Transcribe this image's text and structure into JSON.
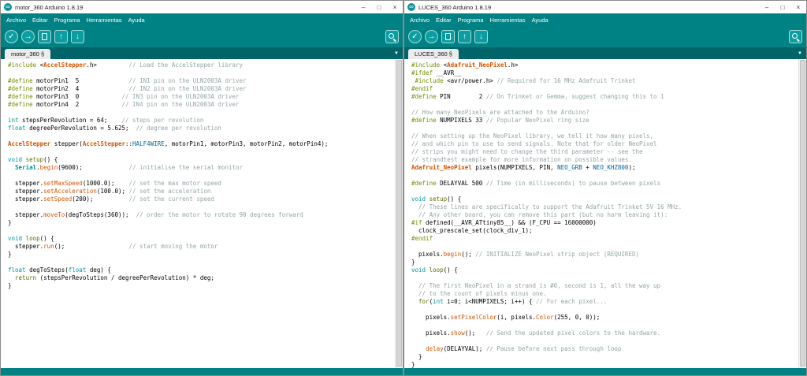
{
  "chrome": {
    "window_controls": {
      "minimize": "–",
      "maximize": "□",
      "close": "×"
    },
    "app_icon_glyph": "∞",
    "tab_menu_glyph": "▼",
    "toolbar": {
      "verify": "✓",
      "upload": "→",
      "open": "↑",
      "save": "↓"
    },
    "colors": {
      "toolbar_teal": "#008184",
      "tabstrip_teal": "#006468",
      "button_teal": "#0c9da1",
      "syntax_type": "#00979C",
      "syntax_function": "#D35400",
      "syntax_preprocessor": "#728E00",
      "syntax_keyword": "#5E6D03",
      "syntax_constant": "#006699",
      "syntax_comment": "#95A5A6"
    }
  },
  "windows": [
    {
      "title": "motor_360 Arduino 1.8.19",
      "menu": [
        "Archivo",
        "Editar",
        "Programa",
        "Herramientas",
        "Ayuda"
      ],
      "tab": "motor_360 §",
      "code": [
        [
          [
            "p",
            "#include "
          ],
          [
            "",
            "<"
          ],
          [
            "cls",
            "AccelStepper"
          ],
          [
            "",
            ".h>"
          ],
          [
            "",
            "         "
          ],
          [
            "c",
            "// Load the AccelStepper library"
          ]
        ],
        [],
        [
          [
            "p",
            "#define"
          ],
          [
            "",
            " motorPin1  5              "
          ],
          [
            "c",
            "// IN1 pin on the ULN2003A driver"
          ]
        ],
        [
          [
            "p",
            "#define"
          ],
          [
            "",
            " motorPin2  4              "
          ],
          [
            "c",
            "// IN2 pin on the ULN2003A driver"
          ]
        ],
        [
          [
            "p",
            "#define"
          ],
          [
            "",
            " motorPin3  0            "
          ],
          [
            "c",
            "// IN3 pin on the ULN2003A driver"
          ]
        ],
        [
          [
            "p",
            "#define"
          ],
          [
            "",
            " motorPin4  2            "
          ],
          [
            "c",
            "// IN4 pin on the ULN2003A driver"
          ]
        ],
        [],
        [
          [
            "t",
            "int"
          ],
          [
            "",
            " stepsPerRevolution = 64;    "
          ],
          [
            "c",
            "// steps per revolution"
          ]
        ],
        [
          [
            "t",
            "float"
          ],
          [
            "",
            " degreePerRevolution = 5.625;  "
          ],
          [
            "c",
            "// degree per revolution"
          ]
        ],
        [],
        [
          [
            "cls",
            "AccelStepper"
          ],
          [
            "",
            " stepper("
          ],
          [
            "cls",
            "AccelStepper"
          ],
          [
            "",
            "::"
          ],
          [
            "const",
            "HALF4WIRE"
          ],
          [
            "",
            ", motorPin1, motorPin3, motorPin2, motorPin4);"
          ]
        ],
        [],
        [
          [
            "t",
            "void"
          ],
          [
            "",
            " "
          ],
          [
            "kw",
            "setup"
          ],
          [
            "",
            "() {"
          ]
        ],
        [
          [
            "",
            "  "
          ],
          [
            "ser",
            "Serial"
          ],
          [
            "",
            "."
          ],
          [
            "fn",
            "begin"
          ],
          [
            "",
            "(9600);             "
          ],
          [
            "c",
            "// initialise the serial monitor"
          ]
        ],
        [],
        [
          [
            "",
            "  stepper."
          ],
          [
            "fn",
            "setMaxSpeed"
          ],
          [
            "",
            "(1000.0);    "
          ],
          [
            "c",
            "// set the max motor speed"
          ]
        ],
        [
          [
            "",
            "  stepper."
          ],
          [
            "fn",
            "setAcceleration"
          ],
          [
            "",
            "(100.0); "
          ],
          [
            "c",
            "// set the acceleration"
          ]
        ],
        [
          [
            "",
            "  stepper."
          ],
          [
            "fn",
            "setSpeed"
          ],
          [
            "",
            "(200);          "
          ],
          [
            "c",
            "// set the current speed"
          ]
        ],
        [],
        [
          [
            "",
            "  stepper."
          ],
          [
            "fn",
            "moveTo"
          ],
          [
            "",
            "(degToSteps(360));  "
          ],
          [
            "c",
            "// order the motor to rotate 90 degrees forward"
          ]
        ],
        [
          [
            "",
            "}"
          ]
        ],
        [],
        [
          [
            "t",
            "void"
          ],
          [
            "",
            " "
          ],
          [
            "kw",
            "loop"
          ],
          [
            "",
            "() {"
          ]
        ],
        [
          [
            "",
            "  stepper."
          ],
          [
            "fn",
            "run"
          ],
          [
            "",
            "();                  "
          ],
          [
            "c",
            "// start moving the motor"
          ]
        ],
        [
          [
            "",
            "}"
          ]
        ],
        [],
        [
          [
            "t",
            "float"
          ],
          [
            "",
            " degToSteps("
          ],
          [
            "t",
            "float"
          ],
          [
            "",
            " deg) {"
          ]
        ],
        [
          [
            "",
            "  "
          ],
          [
            "kw",
            "return"
          ],
          [
            "",
            " (stepsPerRevolution / degreePerRevolution) * deg;"
          ]
        ],
        [
          [
            "",
            "}"
          ]
        ]
      ]
    },
    {
      "title": "LUCES_360 Arduino 1.8.19",
      "menu": [
        "Archivo",
        "Editar",
        "Programa",
        "Herramientas",
        "Ayuda"
      ],
      "tab": "LUCES_360 §",
      "code": [
        [
          [
            "p",
            "#include "
          ],
          [
            "",
            "<"
          ],
          [
            "cls",
            "Adafruit_NeoPixel"
          ],
          [
            "",
            ".h>"
          ]
        ],
        [
          [
            "p",
            "#ifdef"
          ],
          [
            "",
            " __AVR__"
          ]
        ],
        [
          [
            "",
            " "
          ],
          [
            "p",
            "#include "
          ],
          [
            "",
            "<avr/power.h> "
          ],
          [
            "c",
            "// Required for 16 MHz Adafruit Trinket"
          ]
        ],
        [
          [
            "p",
            "#endif"
          ]
        ],
        [
          [
            "p",
            "#define"
          ],
          [
            "",
            " PIN        2 "
          ],
          [
            "c",
            "// On Trinket or Gemma, suggest changing this to 1"
          ]
        ],
        [],
        [
          [
            "c",
            "// How many NeoPixels are attached to the Arduino?"
          ]
        ],
        [
          [
            "p",
            "#define"
          ],
          [
            "",
            " NUMPIXELS 33 "
          ],
          [
            "c",
            "// Popular NeoPixel ring size"
          ]
        ],
        [],
        [
          [
            "c",
            "// When setting up the NeoPixel library, we tell it how many pixels,"
          ]
        ],
        [
          [
            "c",
            "// and which pin to use to send signals. Note that for older NeoPixel"
          ]
        ],
        [
          [
            "c",
            "// strips you might need to change the third parameter -- see the"
          ]
        ],
        [
          [
            "c",
            "// strandtest example for more information on possible values."
          ]
        ],
        [
          [
            "cls",
            "Adafruit_NeoPixel"
          ],
          [
            "",
            " pixels(NUMPIXELS, PIN, "
          ],
          [
            "const",
            "NEO_GRB"
          ],
          [
            "",
            " + "
          ],
          [
            "const",
            "NEO_KHZ800"
          ],
          [
            "",
            ");"
          ]
        ],
        [],
        [
          [
            "p",
            "#define"
          ],
          [
            "",
            " DELAYVAL 500 "
          ],
          [
            "c",
            "// Time (in milliseconds) to pause between pixels"
          ]
        ],
        [],
        [
          [
            "t",
            "void"
          ],
          [
            "",
            " "
          ],
          [
            "kw",
            "setup"
          ],
          [
            "",
            "() {"
          ]
        ],
        [
          [
            "",
            "  "
          ],
          [
            "c",
            "// These lines are specifically to support the Adafruit Trinket 5V 16 MHz."
          ]
        ],
        [
          [
            "",
            "  "
          ],
          [
            "c",
            "// Any other board, you can remove this part (but no harm leaving it):"
          ]
        ],
        [
          [
            "p",
            "#if"
          ],
          [
            "",
            " defined(__AVR_ATtiny85__) && (F_CPU == 16000000)"
          ]
        ],
        [
          [
            "",
            "  clock_prescale_set(clock_div_1);"
          ]
        ],
        [
          [
            "p",
            "#endif"
          ]
        ],
        [],
        [
          [
            "",
            "  pixels."
          ],
          [
            "fn",
            "begin"
          ],
          [
            "",
            "(); "
          ],
          [
            "c",
            "// INITIALIZE NeoPixel strip object (REQUIRED)"
          ]
        ],
        [
          [
            "",
            "}"
          ]
        ],
        [
          [
            "t",
            "void"
          ],
          [
            "",
            " "
          ],
          [
            "kw",
            "loop"
          ],
          [
            "",
            "() {"
          ]
        ],
        [],
        [
          [
            "",
            "  "
          ],
          [
            "c",
            "// The first NeoPixel in a strand is #0, second is 1, all the way up"
          ]
        ],
        [
          [
            "",
            "  "
          ],
          [
            "c",
            "// to the count of pixels minus one."
          ]
        ],
        [
          [
            "",
            "  "
          ],
          [
            "kw",
            "for"
          ],
          [
            "",
            "("
          ],
          [
            "t",
            "int"
          ],
          [
            "",
            " i=0; i<NUMPIXELS; i++) { "
          ],
          [
            "c",
            "// For each pixel..."
          ]
        ],
        [],
        [
          [
            "",
            "    pixels."
          ],
          [
            "fn",
            "setPixelColor"
          ],
          [
            "",
            "(i, pixels."
          ],
          [
            "fn",
            "Color"
          ],
          [
            "",
            "(255, 0, 0));"
          ]
        ],
        [],
        [
          [
            "",
            "    pixels."
          ],
          [
            "fn",
            "show"
          ],
          [
            "",
            "();   "
          ],
          [
            "c",
            "// Send the updated pixel colors to the hardware."
          ]
        ],
        [],
        [
          [
            "",
            "    "
          ],
          [
            "fn",
            "delay"
          ],
          [
            "",
            "(DELAYVAL); "
          ],
          [
            "c",
            "// Pause before next pass through loop"
          ]
        ],
        [
          [
            "",
            "  }"
          ]
        ],
        [
          [
            "",
            "}"
          ]
        ]
      ]
    }
  ]
}
